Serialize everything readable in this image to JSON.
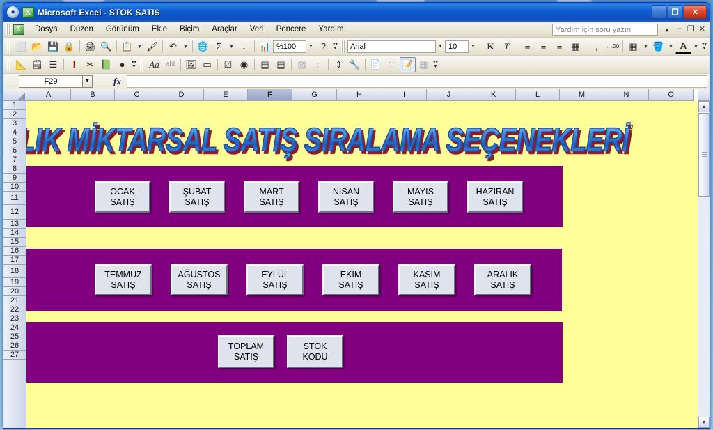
{
  "window": {
    "title": "Microsoft Excel - STOK SATIS",
    "minimize_label": "_",
    "restore_label": "❐",
    "close_label": "✕"
  },
  "menu": {
    "items": [
      {
        "label": "Dosya"
      },
      {
        "label": "Düzen"
      },
      {
        "label": "Görünüm"
      },
      {
        "label": "Ekle"
      },
      {
        "label": "Biçim"
      },
      {
        "label": "Araçlar"
      },
      {
        "label": "Veri"
      },
      {
        "label": "Pencere"
      },
      {
        "label": "Yardım"
      }
    ],
    "help_placeholder": "Yardım için soru yazın",
    "win_minimize": "–",
    "win_restore": "❐",
    "win_close": "✕"
  },
  "toolbar_standard": {
    "icons": [
      {
        "name": "new-document-icon",
        "glyph": "⬜"
      },
      {
        "name": "open-folder-icon",
        "glyph": "📂"
      },
      {
        "name": "save-icon",
        "glyph": "💾"
      },
      {
        "name": "permission-icon",
        "glyph": "🔒"
      },
      {
        "name": "print-icon",
        "glyph": "🖨"
      },
      {
        "name": "print-preview-icon",
        "glyph": "🔍"
      },
      {
        "name": "paste-icon",
        "glyph": "📋"
      },
      {
        "name": "format-painter-icon",
        "glyph": "🖌"
      },
      {
        "name": "undo-icon",
        "glyph": "↶"
      },
      {
        "name": "redo-icon",
        "glyph": "↷"
      },
      {
        "name": "hyperlink-icon",
        "glyph": "🌐"
      },
      {
        "name": "autosum-icon",
        "glyph": "Σ"
      },
      {
        "name": "sort-ascending-icon",
        "glyph": "↓"
      },
      {
        "name": "chart-wizard-icon",
        "glyph": "📊"
      },
      {
        "name": "help-icon",
        "glyph": "?"
      }
    ],
    "zoom_value": "%100"
  },
  "toolbar_formatting": {
    "font_name": "Arial",
    "font_size": "10",
    "bold_label": "K",
    "italic_label": "T",
    "icons": [
      {
        "name": "align-left-icon",
        "glyph": "≡"
      },
      {
        "name": "align-center-icon",
        "glyph": "≡"
      },
      {
        "name": "align-right-icon",
        "glyph": "≡"
      },
      {
        "name": "merge-cells-icon",
        "glyph": "▦"
      },
      {
        "name": "comma-style-icon",
        "glyph": ","
      },
      {
        "name": "decrease-decimal-icon",
        "glyph": "←.00"
      },
      {
        "name": "borders-icon",
        "glyph": "▦"
      },
      {
        "name": "fill-color-icon",
        "glyph": "🪣"
      },
      {
        "name": "font-color-icon",
        "glyph": "A"
      }
    ]
  },
  "toolbar_vb": {
    "icons": [
      {
        "name": "design-mode-icon",
        "glyph": "📐"
      },
      {
        "name": "properties-icon",
        "glyph": "🗒"
      },
      {
        "name": "view-code-icon",
        "glyph": "☰"
      },
      {
        "name": "run-macro-icon",
        "glyph": "!"
      },
      {
        "name": "control-wizard-icon",
        "glyph": "✂"
      },
      {
        "name": "visual-basic-editor-icon",
        "glyph": "📗"
      },
      {
        "name": "microsoft-script-editor-icon",
        "glyph": "●"
      }
    ]
  },
  "toolbar_controls": {
    "icons": [
      {
        "name": "label-control-icon",
        "glyph": "Aa"
      },
      {
        "name": "textbox-control-icon",
        "glyph": "abl"
      },
      {
        "name": "image-control-icon",
        "glyph": "🖼"
      },
      {
        "name": "commandbutton-control-icon",
        "glyph": "▭"
      },
      {
        "name": "checkbox-control-icon",
        "glyph": "☑"
      },
      {
        "name": "optionbutton-control-icon",
        "glyph": "◉"
      },
      {
        "name": "listbox-control-icon",
        "glyph": "▤"
      },
      {
        "name": "combobox-control-icon",
        "glyph": "▤"
      },
      {
        "name": "togglebutton-control-icon",
        "glyph": "▧"
      },
      {
        "name": "spinbutton-control-icon",
        "glyph": "↕"
      },
      {
        "name": "scrollbar-control-icon",
        "glyph": "⇕"
      },
      {
        "name": "more-controls-icon",
        "glyph": "🔧"
      },
      {
        "name": "properties-window-icon",
        "glyph": "📄"
      },
      {
        "name": "design-grid-icon",
        "glyph": "∷"
      },
      {
        "name": "view-code-2-icon",
        "glyph": "📝"
      }
    ]
  },
  "formula_bar": {
    "name_box_value": "F29",
    "fx_label": "fx",
    "formula_value": ""
  },
  "grid": {
    "columns": [
      "A",
      "B",
      "C",
      "D",
      "E",
      "F",
      "G",
      "H",
      "I",
      "J",
      "K",
      "L",
      "M",
      "N",
      "O"
    ],
    "active_column": "F",
    "rows": [
      1,
      2,
      3,
      4,
      5,
      6,
      7,
      8,
      9,
      10,
      11,
      12,
      13,
      14,
      15,
      16,
      17,
      18,
      19,
      20,
      21,
      22,
      23,
      24,
      25,
      26,
      27
    ],
    "sheet_background": "#FFFF99",
    "band_color": "#800080"
  },
  "sheet": {
    "wordart_title": "AYLIK MİKTARSAL SATIŞ SIRALAMA SEÇENEKLERİ",
    "button_groups": [
      {
        "name": "first-half-months",
        "buttons": [
          {
            "line1": "OCAK",
            "line2": "SATIŞ"
          },
          {
            "line1": "ŞUBAT",
            "line2": "SATIŞ"
          },
          {
            "line1": "MART",
            "line2": "SATIŞ"
          },
          {
            "line1": "NİSAN",
            "line2": "SATIŞ"
          },
          {
            "line1": "MAYIS",
            "line2": "SATIŞ"
          },
          {
            "line1": "HAZİRAN",
            "line2": "SATIŞ"
          }
        ]
      },
      {
        "name": "second-half-months",
        "buttons": [
          {
            "line1": "TEMMUZ",
            "line2": "SATIŞ"
          },
          {
            "line1": "AĞUSTOS",
            "line2": "SATIŞ"
          },
          {
            "line1": "EYLÜL",
            "line2": "SATIŞ"
          },
          {
            "line1": "EKİM",
            "line2": "SATIŞ"
          },
          {
            "line1": "KASIM",
            "line2": "SATIŞ"
          },
          {
            "line1": "ARALIK",
            "line2": "SATIŞ"
          }
        ]
      },
      {
        "name": "totals",
        "buttons": [
          {
            "line1": "TOPLAM",
            "line2": "SATIŞ"
          },
          {
            "line1": "STOK",
            "line2": "KODU"
          }
        ]
      }
    ]
  },
  "scrollbar": {
    "up_arrow": "▲",
    "down_arrow": "▼"
  }
}
